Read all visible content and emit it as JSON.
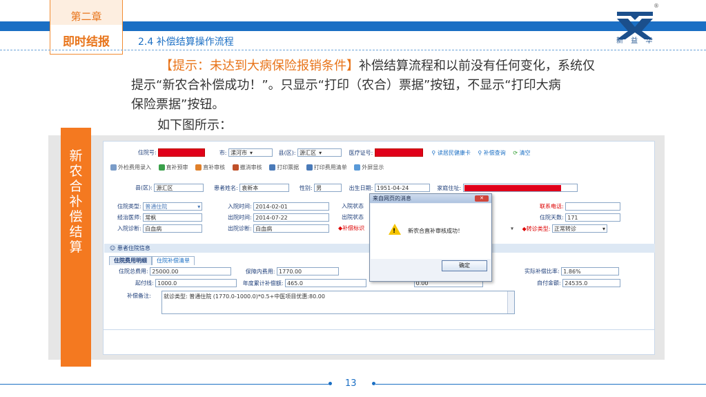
{
  "header": {
    "chapter": "第二章",
    "section_tag": "即时结报",
    "section_title": "2.4 补偿结算操作流程",
    "logo_text": "新 益 华",
    "logo_reg": "®"
  },
  "body": {
    "tip_bracket_open": "【",
    "tip_label": "提示：未达到大病保险报销条件",
    "tip_bracket_close": "】",
    "tip_text_1": "补偿结算流程和以前没有任何变化，系统仅",
    "line2": "提示“新农合补偿成功！”。只显示“打印（农合）票据”按钮，不显示“打印大病",
    "line3": "保险票据”按钮。",
    "line4": "如下图所示："
  },
  "side_tab": "新农合补偿结算",
  "screen": {
    "row1": {
      "zhuyuanhao_label": "住院号:",
      "shi_label": "市:",
      "shi_value": "漯河市",
      "xian_label": "县(区):",
      "xian_value": "源汇区",
      "yiliao_label": "医疗证号:",
      "read_card": "读居民健康卡",
      "query": "补偿查询",
      "clear": "清空"
    },
    "toolbar": [
      "外检费用录入",
      "直补预审",
      "直补审核",
      "撤消审核",
      "打印票据",
      "打印费用清单",
      "外屏显示"
    ],
    "row2": {
      "xian_label": "县(区):",
      "xian_value": "源汇区",
      "name_label": "患者姓名:",
      "name_value": "袁新本",
      "sex_label": "性别:",
      "sex_value": "男",
      "birth_label": "出生日期:",
      "birth_value": "1951-04-24",
      "addr_label": "家庭住址:"
    },
    "left_fields": [
      {
        "label": "住院类型:",
        "value": "普通住院"
      },
      {
        "label": "经治医师:",
        "value": "常枫"
      },
      {
        "label": "入院诊断:",
        "value": "白血病"
      }
    ],
    "mid_fields": [
      {
        "label": "入院时间:",
        "value": "2014-02-01"
      },
      {
        "label": "出院时间:",
        "value": "2014-07-22"
      },
      {
        "label": "出院诊断:",
        "value": "白血病"
      }
    ],
    "mid2_labels": [
      "入院状态",
      "出院状态",
      "◆补偿标识"
    ],
    "right_fields": {
      "phone_label": "联系电话:",
      "days_label": "住院天数:",
      "days_value": "171",
      "transfer_label": "◆转诊类型:",
      "transfer_value": "正常转诊"
    },
    "section_bar": "患者住院信息",
    "tabs": [
      "住院费用明细",
      "住院补偿清单"
    ],
    "detail": {
      "total_label": "住院总费用:",
      "total_value": "25000.00",
      "protect_label": "保障内费用:",
      "protect_value": "1770.00",
      "ratio_label": "实际补偿比率:",
      "ratio_value": "1.86%",
      "start_label": "起付线:",
      "start_value": "1000.0",
      "annual_label": "年度累计补偿额:",
      "annual_value": "465.0",
      "hidden_value": "0.00",
      "self_label": "自付金额:",
      "self_value": "24535.0",
      "note_label": "补偿备注:",
      "note_value": "就诊类型: 普通住院 (1770.0-1000.0)*0.5+中医项目优惠:80.00"
    },
    "dialog": {
      "title": "来自网页的消息",
      "close": "✕",
      "message": "新农合直补审核成功！",
      "ok": "确定"
    }
  },
  "footer": {
    "page": "13"
  },
  "colors": {
    "brand_blue": "#1b6fc4",
    "accent_orange": "#e8741a",
    "redact": "#e0001a"
  }
}
